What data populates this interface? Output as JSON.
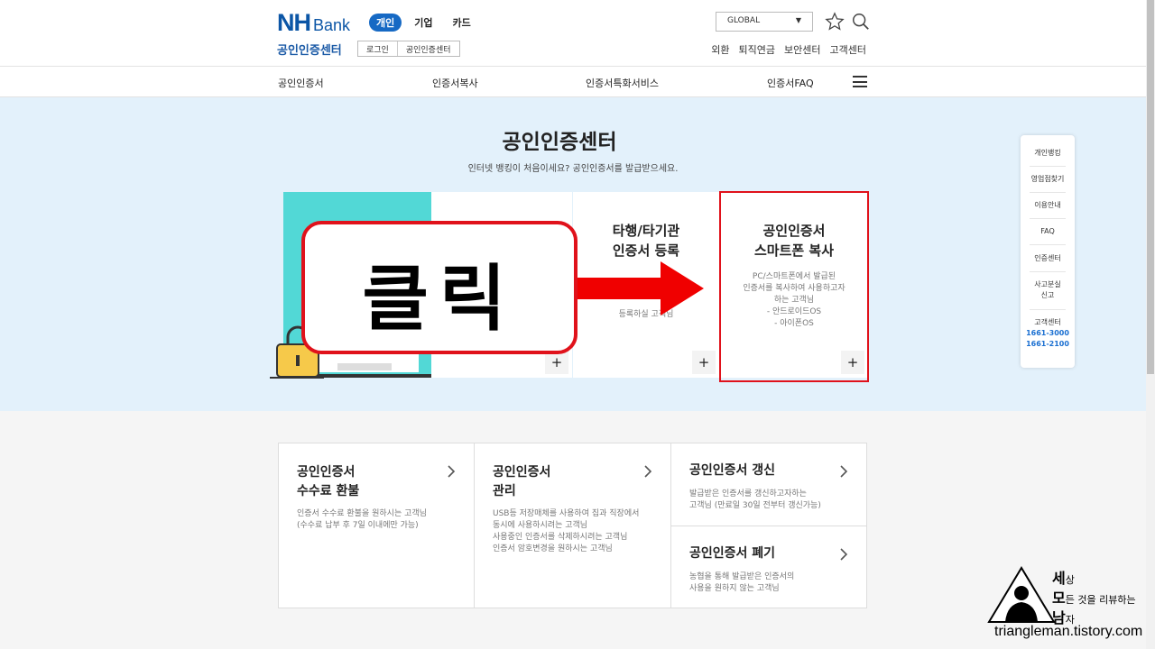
{
  "header": {
    "logo_nh": "NH",
    "logo_bank": "Bank",
    "tabs": [
      "개인",
      "기업",
      "카드"
    ],
    "center_title": "공인인증센터",
    "login_btn": "로그인",
    "cert_center_btn": "공인인증센터",
    "global_select": "GLOBAL",
    "util_links": [
      "외환",
      "퇴직연금",
      "보안센터",
      "고객센터"
    ]
  },
  "nav": {
    "items": [
      "공인인증서",
      "인증서복사",
      "인증서특화서비스",
      "인증서FAQ"
    ]
  },
  "hero": {
    "title": "공인인증센터",
    "subtitle": "인터넷 뱅킹이 처음이세요? 공인인증서를 발급받으세요.",
    "card2": {
      "title_l1": "타행/타기관",
      "title_l2": "인증서 등록",
      "desc": "등록하실 고객님"
    },
    "card3": {
      "title_l1": "공인인증서",
      "title_l2": "스마트폰 복사",
      "desc_lines": [
        "PC/스마트폰에서 발급된",
        "인증서를 복사하여 사용하고자",
        "하는 고객님",
        "- 안드로이드OS",
        "- 아이폰OS"
      ]
    },
    "plus": "+",
    "overlay_click": "클릭"
  },
  "quick_menu": {
    "items": [
      "개인뱅킹",
      "영업점찾기",
      "이용안내",
      "FAQ",
      "인증센터"
    ],
    "report_l1": "사고분실",
    "report_l2": "신고",
    "center_label": "고객센터",
    "phone1": "1661-3000",
    "phone2": "1661-2100"
  },
  "services": {
    "refund": {
      "title_l1": "공인인증서",
      "title_l2": "수수료 환불",
      "desc_lines": [
        "인증서 수수료 환불을 원하시는 고객님",
        "(수수료 납부 후 7일 이내에만 가능)"
      ]
    },
    "manage": {
      "title_l1": "공인인증서",
      "title_l2": "관리",
      "desc_lines": [
        "USB등 저장매체를 사용하여 집과 직장에서",
        "동시에 사용하시려는 고객님",
        "사용중인 인증서를 삭제하시려는 고객님",
        "인증서 암호변경을 원하시는 고객님"
      ]
    },
    "renew": {
      "title": "공인인증서 갱신",
      "desc_lines": [
        "발급받은 인증서를 갱신하고자하는",
        "고객님 (만료일 30일 전부터 갱신가능)"
      ]
    },
    "revoke": {
      "title": "공인인증서 폐기",
      "desc_lines": [
        "농협을 통해 발급받은 인증서의",
        "사용을 원하지 않는 고객님"
      ]
    }
  },
  "watermark": {
    "c1": "세",
    "c1_small": "상",
    "c2": "모",
    "c2_small": "든 것을 리뷰하는",
    "c3": "남",
    "c3_small": "자",
    "url": "triangleman.tistory.com"
  }
}
